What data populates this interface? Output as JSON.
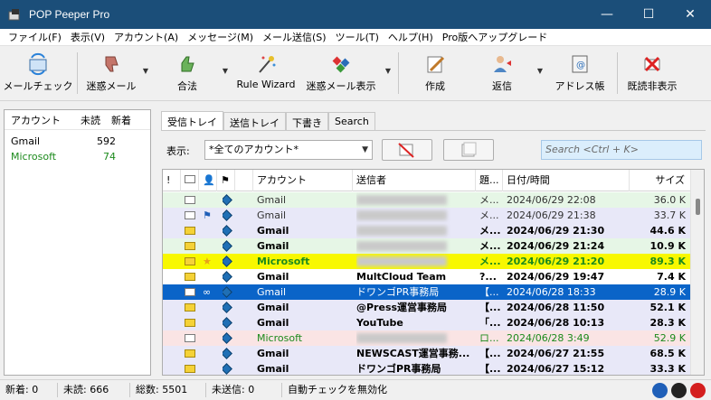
{
  "window": {
    "title": "POP Peeper Pro",
    "minimize": "—",
    "maximize": "☐",
    "close": "✕"
  },
  "menu": [
    "ファイル(F)",
    "表示(V)",
    "アカウント(A)",
    "メッセージ(M)",
    "メール送信(S)",
    "ツール(T)",
    "ヘルプ(H)",
    "Pro版へアップグレード"
  ],
  "toolbar": {
    "check_mail": "メールチェック",
    "spam": "迷惑メール",
    "legit": "合法",
    "rule_wizard": "Rule Wizard",
    "spam_view": "迷惑メール表示",
    "compose": "作成",
    "reply": "返信",
    "address_book": "アドレス帳",
    "hide_read": "既読非表示"
  },
  "accounts": {
    "headers": {
      "account": "アカウント",
      "unread": "未読",
      "new": "新着"
    },
    "rows": [
      {
        "name": "Gmail",
        "unread": "592",
        "new": "",
        "color": "#000000"
      },
      {
        "name": "Microsoft",
        "unread": "74",
        "new": "",
        "color": "#1c8a1c"
      }
    ]
  },
  "tabs": [
    "受信トレイ",
    "送信トレイ",
    "下書き",
    "Search"
  ],
  "filter": {
    "label": "表示:",
    "value": "*全てのアカウント*",
    "search_placeholder": "Search <Ctrl + K>"
  },
  "grid": {
    "headers": {
      "flag": "!",
      "account": "アカウント",
      "sender": "送信者",
      "subject": "題...",
      "date": "日付/時間",
      "size": "サイズ"
    },
    "rows": [
      {
        "account": "Gmail",
        "sender": "",
        "subject": "メ...",
        "date": "2024/06/29 22:08",
        "size": "36.0 K",
        "bold": false,
        "unread": false,
        "bg": "#e6f6e6",
        "fg": "#333333",
        "mark": ""
      },
      {
        "account": "Gmail",
        "sender": "",
        "subject": "メ...",
        "date": "2024/06/29 21:38",
        "size": "33.7 K",
        "bold": false,
        "unread": false,
        "bg": "#e8e8f8",
        "fg": "#333333",
        "mark": "flag"
      },
      {
        "account": "Gmail",
        "sender": "",
        "subject": "メ...",
        "date": "2024/06/29 21:30",
        "size": "44.6 K",
        "bold": true,
        "unread": true,
        "bg": "#e8e8f8",
        "fg": "#000000",
        "mark": ""
      },
      {
        "account": "Gmail",
        "sender": "",
        "subject": "メ...",
        "date": "2024/06/29 21:24",
        "size": "10.9 K",
        "bold": true,
        "unread": true,
        "bg": "#e6f6e6",
        "fg": "#000000",
        "mark": ""
      },
      {
        "account": "Microsoft",
        "sender": "",
        "subject": "メ...",
        "date": "2024/06/29 21:20",
        "size": "89.3 K",
        "bold": true,
        "unread": true,
        "bg": "#f8f800",
        "fg": "#1c8a1c",
        "mark": "star"
      },
      {
        "account": "Gmail",
        "sender": "MultCloud Team",
        "subject": "?...",
        "date": "2024/06/29 19:47",
        "size": "7.4 K",
        "bold": true,
        "unread": true,
        "bg": "#ffffff",
        "fg": "#000000",
        "mark": ""
      },
      {
        "account": "Gmail",
        "sender": "ドワンゴPR事務局",
        "subject": "【...",
        "date": "2024/06/28 18:33",
        "size": "28.9 K",
        "bold": false,
        "unread": false,
        "bg": "#0a64c8",
        "fg": "#ffffff",
        "mark": "glasses"
      },
      {
        "account": "Gmail",
        "sender": "@Press運営事務局",
        "subject": "【...",
        "date": "2024/06/28 11:50",
        "size": "52.1 K",
        "bold": true,
        "unread": true,
        "bg": "#e8e8f8",
        "fg": "#000000",
        "mark": ""
      },
      {
        "account": "Gmail",
        "sender": "YouTube",
        "subject": "「...",
        "date": "2024/06/28 10:13",
        "size": "28.3 K",
        "bold": true,
        "unread": true,
        "bg": "#e8e8f8",
        "fg": "#000000",
        "mark": ""
      },
      {
        "account": "Microsoft",
        "sender": "",
        "subject": "ロ...",
        "date": "2024/06/28 3:49",
        "size": "52.9 K",
        "bold": false,
        "unread": false,
        "bg": "#fae4e4",
        "fg": "#1c8a1c",
        "mark": ""
      },
      {
        "account": "Gmail",
        "sender": "NEWSCAST運営事務...",
        "subject": "【...",
        "date": "2024/06/27 21:55",
        "size": "68.5 K",
        "bold": true,
        "unread": true,
        "bg": "#e8e8f8",
        "fg": "#000000",
        "mark": ""
      },
      {
        "account": "Gmail",
        "sender": "ドワンゴPR事務局",
        "subject": "【...",
        "date": "2024/06/27 15:12",
        "size": "33.3 K",
        "bold": true,
        "unread": true,
        "bg": "#e8e8f8",
        "fg": "#000000",
        "mark": ""
      }
    ]
  },
  "status": {
    "new": "新着: 0",
    "unread": "未読: 666",
    "total": "総数: 5501",
    "unsent": "未送信: 0",
    "auto": "自動チェックを無効化"
  }
}
